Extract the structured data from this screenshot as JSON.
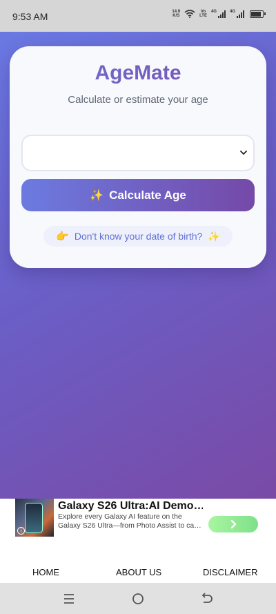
{
  "status_bar": {
    "time": "9:53 AM",
    "net_speed_value": "14.9",
    "net_speed_unit": "K/S",
    "volte_top": "Vo",
    "volte_bottom": "LTE",
    "sim1_label": "4G",
    "sim2_label": "4G",
    "battery_level": 0.8
  },
  "app": {
    "title": "AgeMate",
    "subtitle": "Calculate or estimate your age",
    "dob_select": {
      "value": ""
    },
    "calculate_button": {
      "emoji": "✨",
      "label": "Calculate Age"
    },
    "dont_know": {
      "emoji_left": "👉",
      "label": "Don't know your date of birth?",
      "emoji_right": "✨"
    }
  },
  "ad": {
    "title": "Galaxy S26 Ultra:AI Demo…",
    "description": "Explore every Galaxy AI feature on the Galaxy S26 Ultra—from Photo Assist to ca…",
    "cta_icon": "chevron-right-icon"
  },
  "bottom_nav": {
    "items": [
      {
        "label": "HOME"
      },
      {
        "label": "ABOUT US"
      },
      {
        "label": "DISCLAIMER"
      }
    ]
  },
  "colors": {
    "gradient_start": "#6a79e3",
    "gradient_end": "#7a4aa6",
    "accent_text": "#5f6fd4",
    "cta_green": "#7fe08a"
  }
}
